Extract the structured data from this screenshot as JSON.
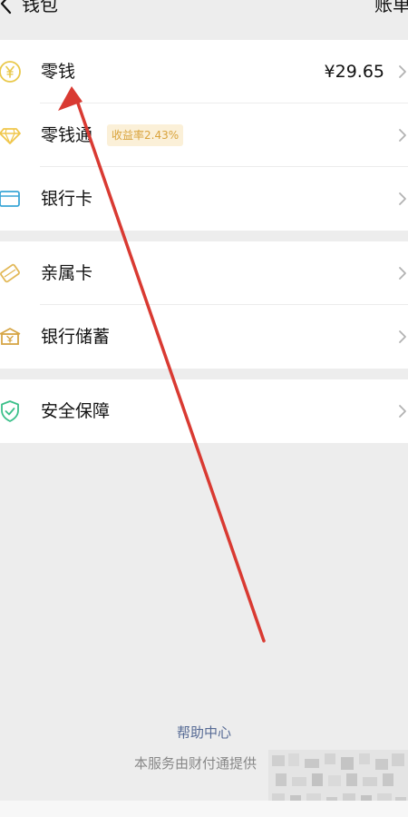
{
  "header": {
    "title": "钱包",
    "right_link": "账单",
    "back_icon": "chevron-left-icon"
  },
  "groups": [
    {
      "items": [
        {
          "label": "零钱",
          "value": "¥29.65",
          "icon": "yuan-coin-icon"
        },
        {
          "label": "零钱通",
          "badge": "收益率2.43%",
          "icon": "diamond-icon"
        },
        {
          "label": "银行卡",
          "icon": "bank-card-icon"
        }
      ]
    },
    {
      "items": [
        {
          "label": "亲属卡",
          "icon": "family-card-icon"
        },
        {
          "label": "银行储蓄",
          "icon": "savings-box-icon"
        }
      ]
    },
    {
      "items": [
        {
          "label": "安全保障",
          "icon": "shield-check-icon"
        }
      ]
    }
  ],
  "footer": {
    "help": "帮助中心",
    "provider": "本服务由财付通提供"
  },
  "colors": {
    "background": "#ededed",
    "card": "#ffffff",
    "link": "#576b95",
    "coin": "#e9c84a",
    "diamond": "#f0c64a",
    "bank_card": "#3aa6d6",
    "family_card": "#e2b857",
    "savings": "#d6a545",
    "shield": "#3cc08a",
    "badge_bg": "#fbf0d8",
    "badge_text": "#d9a33c",
    "annotation_arrow": "#d93a32"
  }
}
